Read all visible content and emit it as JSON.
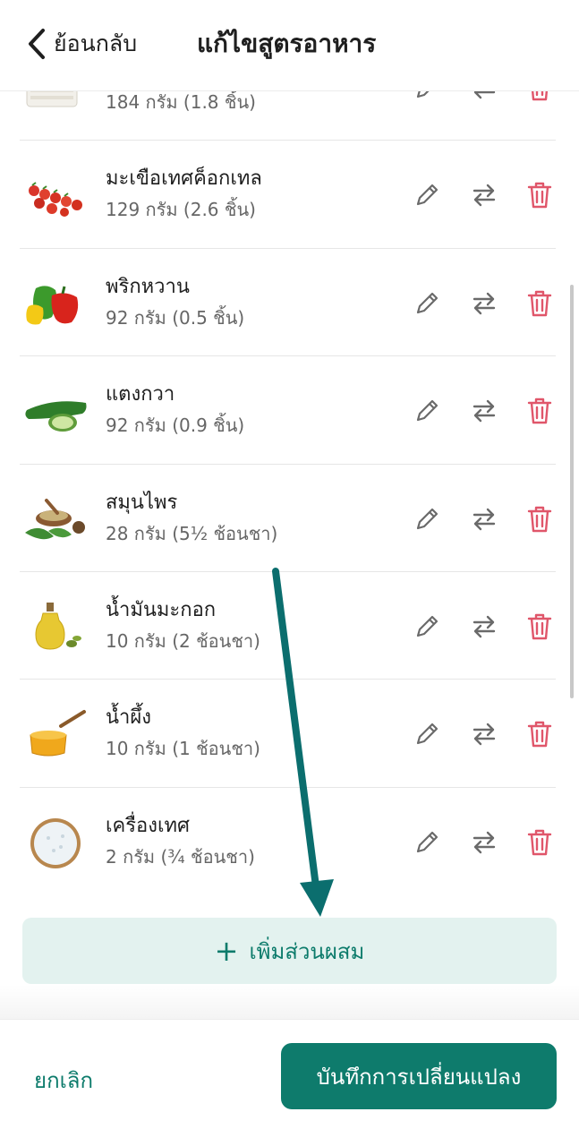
{
  "header": {
    "back_label": "ย้อนกลับ",
    "title": "แก้ไขสูตรอาหาร"
  },
  "ingredients": [
    {
      "name": "",
      "amount": "184 กรัม (1.8 ชิ้น)",
      "icon": "bread-basket-image"
    },
    {
      "name": "มะเขือเทศค็อกเทล",
      "amount": "129 กรัม (2.6 ชิ้น)",
      "icon": "cherry-tomatoes-image"
    },
    {
      "name": "พริกหวาน",
      "amount": "92 กรัม (0.5 ชิ้น)",
      "icon": "bell-peppers-image"
    },
    {
      "name": "แตงกวา",
      "amount": "92 กรัม (0.9 ชิ้น)",
      "icon": "cucumber-image"
    },
    {
      "name": "สมุนไพร",
      "amount": "28 กรัม (5½ ช้อนชา)",
      "icon": "herbs-spices-image"
    },
    {
      "name": "น้ำมันมะกอก",
      "amount": "10 กรัม (2 ช้อนชา)",
      "icon": "olive-oil-image"
    },
    {
      "name": "น้ำผึ้ง",
      "amount": "10 กรัม (1 ช้อนชา)",
      "icon": "honey-image"
    },
    {
      "name": "เครื่องเทศ",
      "amount": "2 กรัม (¾ ช้อนชา)",
      "icon": "salt-bowl-image"
    }
  ],
  "add_button": {
    "label": "เพิ่มส่วนผสม"
  },
  "footer": {
    "cancel_label": "ยกเลิก",
    "save_label": "บันทึกการเปลี่ยนแปลง"
  },
  "colors": {
    "accent": "#0e7b6c",
    "delete": "#e0566a",
    "annotation_arrow": "#0b6e6e"
  }
}
